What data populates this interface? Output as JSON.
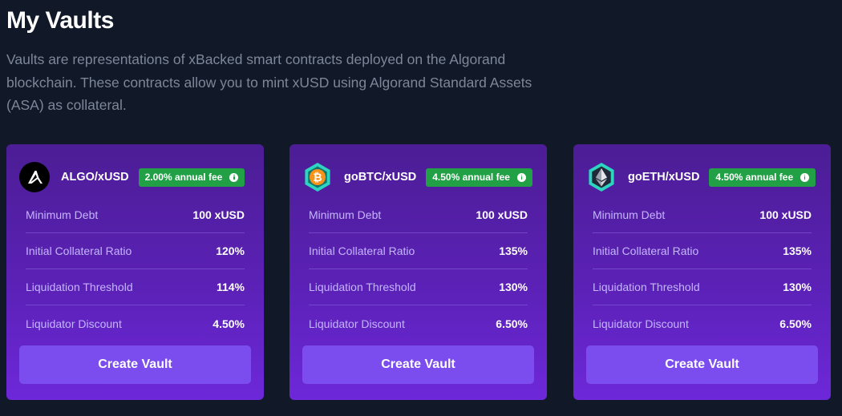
{
  "header": {
    "title": "My Vaults",
    "description": "Vaults are representations of xBacked smart contracts deployed on the Algorand blockchain. These contracts allow you to mint xUSD using Algorand Standard Assets (ASA) as collateral."
  },
  "vaults": [
    {
      "name": "ALGO/xUSD",
      "icon": "algorand-logo-icon",
      "fee": "2.00% annual fee",
      "stats": [
        {
          "label": "Minimum Debt",
          "value": "100 xUSD"
        },
        {
          "label": "Initial Collateral Ratio",
          "value": "120%"
        },
        {
          "label": "Liquidation Threshold",
          "value": "114%"
        },
        {
          "label": "Liquidator Discount",
          "value": "4.50%"
        }
      ],
      "button": "Create Vault"
    },
    {
      "name": "goBTC/xUSD",
      "icon": "bitcoin-logo-icon",
      "fee": "4.50% annual fee",
      "stats": [
        {
          "label": "Minimum Debt",
          "value": "100 xUSD"
        },
        {
          "label": "Initial Collateral Ratio",
          "value": "135%"
        },
        {
          "label": "Liquidation Threshold",
          "value": "130%"
        },
        {
          "label": "Liquidator Discount",
          "value": "6.50%"
        }
      ],
      "button": "Create Vault"
    },
    {
      "name": "goETH/xUSD",
      "icon": "ethereum-logo-icon",
      "fee": "4.50% annual fee",
      "stats": [
        {
          "label": "Minimum Debt",
          "value": "100 xUSD"
        },
        {
          "label": "Initial Collateral Ratio",
          "value": "135%"
        },
        {
          "label": "Liquidation Threshold",
          "value": "130%"
        },
        {
          "label": "Liquidator Discount",
          "value": "6.50%"
        }
      ],
      "button": "Create Vault"
    }
  ],
  "colors": {
    "background": "#111827",
    "card_top": "#4c1d95",
    "card_bottom": "#6d28d9",
    "button": "#7c4dee",
    "fee_badge": "#22a046"
  }
}
